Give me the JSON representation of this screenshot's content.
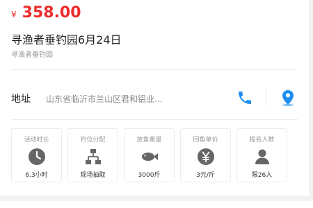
{
  "price": {
    "currency": "¥",
    "amount": "358.00"
  },
  "title": "寻渔者垂钓园6月24日",
  "subtitle": "寻渔者垂钓园",
  "address": {
    "label": "地址",
    "text": "山东省临沂市兰山区君和铝业…",
    "accent_color": "#1f8ef1"
  },
  "stats": [
    {
      "label": "活动时长",
      "value": "6.3小时",
      "icon": "clock-icon"
    },
    {
      "label": "钓位分配",
      "value": "现场抽取",
      "icon": "org-chart-icon"
    },
    {
      "label": "放鱼重量",
      "value": "3000斤",
      "icon": "fish-icon"
    },
    {
      "label": "回鱼单价",
      "value": "3元/斤",
      "icon": "yen-coin-icon"
    },
    {
      "label": "报名人数",
      "value": "限26人",
      "icon": "person-icon"
    }
  ]
}
